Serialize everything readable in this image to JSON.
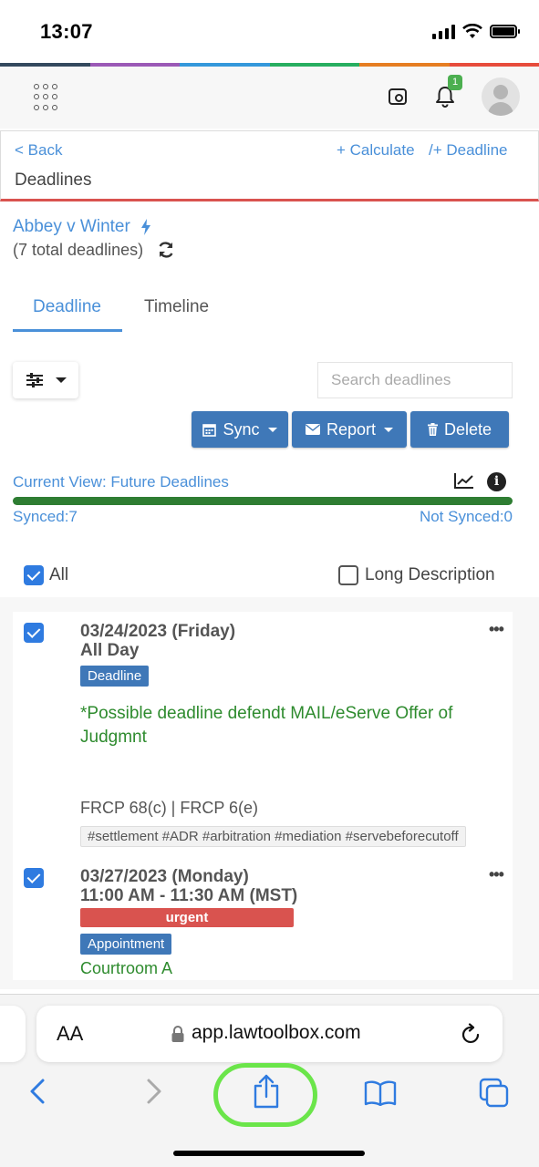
{
  "status_bar": {
    "time": "13:07"
  },
  "colors": {
    "accent": "#4a90d9",
    "button": "#3f78b8",
    "urgent": "#d9534f",
    "description": "#2e8b2e",
    "progress": "#2e7d32",
    "stripe": [
      "#34495e",
      "#9b59b6",
      "#3498db",
      "#27ae60",
      "#e67e22",
      "#e74c3c"
    ]
  },
  "header": {
    "notification_count": "1"
  },
  "nav": {
    "back": "< Back",
    "calculate": "+ Calculate",
    "deadline": "/+ Deadline",
    "title": "Deadlines"
  },
  "case": {
    "name": "Abbey v Winter",
    "total": "(7 total deadlines)"
  },
  "tabs": [
    {
      "label": "Deadline",
      "active": true
    },
    {
      "label": "Timeline",
      "active": false
    }
  ],
  "search": {
    "placeholder": "Search deadlines"
  },
  "actions": {
    "sync": "Sync",
    "report": "Report",
    "delete": "Delete"
  },
  "view": {
    "current": "Current View: Future Deadlines",
    "synced": "Synced:7",
    "not_synced": "Not Synced:0",
    "progress": 1.0
  },
  "select": {
    "all": "All",
    "long_description": "Long Description"
  },
  "items": [
    {
      "date": "03/24/2023 (Friday)",
      "time": "All Day",
      "badge": "Deadline",
      "description": "*Possible deadline defendt MAIL/eServe Offer of Judgmnt",
      "rules": "FRCP 68(c)  |  FRCP 6(e)",
      "tags": "#settlement #ADR #arbitration #mediation #servebeforecutoff"
    },
    {
      "date": "03/27/2023 (Monday)",
      "time": "11:00 AM - 11:30 AM (MST)",
      "priority": "urgent",
      "badge": "Appointment",
      "location": "Courtroom A"
    }
  ],
  "safari": {
    "url": "app.lawtoolbox.com",
    "text_size": "AA"
  }
}
